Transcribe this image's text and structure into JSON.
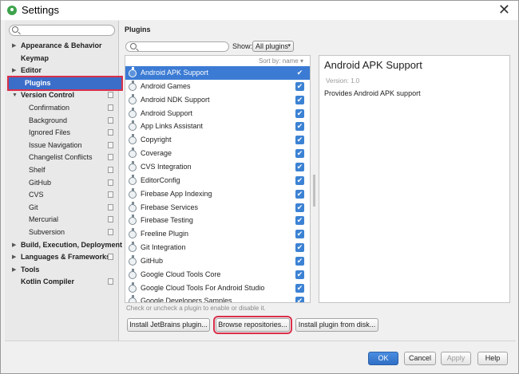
{
  "window": {
    "title": "Settings",
    "close_glyph": "✕"
  },
  "sidebar": {
    "search_placeholder": "",
    "items": [
      {
        "label": "Appearance & Behavior",
        "bold": true,
        "arrow": "▶",
        "indent": 0,
        "proj": false
      },
      {
        "label": "Keymap",
        "bold": true,
        "arrow": "",
        "indent": 0,
        "proj": false
      },
      {
        "label": "Editor",
        "bold": true,
        "arrow": "▶",
        "indent": 0,
        "proj": false
      },
      {
        "label": "Plugins",
        "bold": true,
        "arrow": "",
        "indent": 0,
        "proj": false,
        "selected": true
      },
      {
        "label": "Version Control",
        "bold": true,
        "arrow": "▼",
        "indent": 0,
        "proj": true
      },
      {
        "label": "Confirmation",
        "bold": false,
        "arrow": "",
        "indent": 1,
        "proj": true
      },
      {
        "label": "Background",
        "bold": false,
        "arrow": "",
        "indent": 1,
        "proj": true
      },
      {
        "label": "Ignored Files",
        "bold": false,
        "arrow": "",
        "indent": 1,
        "proj": true
      },
      {
        "label": "Issue Navigation",
        "bold": false,
        "arrow": "",
        "indent": 1,
        "proj": true
      },
      {
        "label": "Changelist Conflicts",
        "bold": false,
        "arrow": "",
        "indent": 1,
        "proj": true
      },
      {
        "label": "Shelf",
        "bold": false,
        "arrow": "",
        "indent": 1,
        "proj": true
      },
      {
        "label": "GitHub",
        "bold": false,
        "arrow": "",
        "indent": 1,
        "proj": true
      },
      {
        "label": "CVS",
        "bold": false,
        "arrow": "",
        "indent": 1,
        "proj": true
      },
      {
        "label": "Git",
        "bold": false,
        "arrow": "",
        "indent": 1,
        "proj": true
      },
      {
        "label": "Mercurial",
        "bold": false,
        "arrow": "",
        "indent": 1,
        "proj": true
      },
      {
        "label": "Subversion",
        "bold": false,
        "arrow": "",
        "indent": 1,
        "proj": true
      },
      {
        "label": "Build, Execution, Deployment",
        "bold": true,
        "arrow": "▶",
        "indent": 0,
        "proj": false
      },
      {
        "label": "Languages & Frameworks",
        "bold": true,
        "arrow": "▶",
        "indent": 0,
        "proj": true
      },
      {
        "label": "Tools",
        "bold": true,
        "arrow": "▶",
        "indent": 0,
        "proj": false
      },
      {
        "label": "Kotlin Compiler",
        "bold": true,
        "arrow": "",
        "indent": 0,
        "proj": true
      }
    ]
  },
  "plugins_panel": {
    "title": "Plugins",
    "search_placeholder": "",
    "show_label": "Show:",
    "show_value": "All plugins",
    "sort_label": "Sort by: name ▾",
    "plugins": [
      {
        "name": "Android APK Support",
        "checked": true,
        "selected": true
      },
      {
        "name": "Android Games",
        "checked": true
      },
      {
        "name": "Android NDK Support",
        "checked": true
      },
      {
        "name": "Android Support",
        "checked": true
      },
      {
        "name": "App Links Assistant",
        "checked": true
      },
      {
        "name": "Copyright",
        "checked": true
      },
      {
        "name": "Coverage",
        "checked": true
      },
      {
        "name": "CVS Integration",
        "checked": true
      },
      {
        "name": "EditorConfig",
        "checked": true
      },
      {
        "name": "Firebase App Indexing",
        "checked": true
      },
      {
        "name": "Firebase Services",
        "checked": true
      },
      {
        "name": "Firebase Testing",
        "checked": true
      },
      {
        "name": "Freeline Plugin",
        "checked": true
      },
      {
        "name": "Git Integration",
        "checked": true
      },
      {
        "name": "GitHub",
        "checked": true
      },
      {
        "name": "Google Cloud Tools Core",
        "checked": true
      },
      {
        "name": "Google Cloud Tools For Android Studio",
        "checked": true
      },
      {
        "name": "Google Developers Samples",
        "checked": true
      }
    ],
    "hint": "Check or uncheck a plugin to enable or disable it."
  },
  "detail": {
    "title": "Android APK Support",
    "version": "Version: 1.0",
    "description": "Provides Android APK support"
  },
  "buttons": {
    "install_jetbrains": "Install JetBrains plugin...",
    "browse_repos": "Browse repositories...",
    "install_disk": "Install plugin from disk...",
    "ok": "OK",
    "cancel": "Cancel",
    "apply": "Apply",
    "help": "Help"
  },
  "colors": {
    "selection": "#3b7bd4",
    "highlight_outline": "#d9304a"
  }
}
